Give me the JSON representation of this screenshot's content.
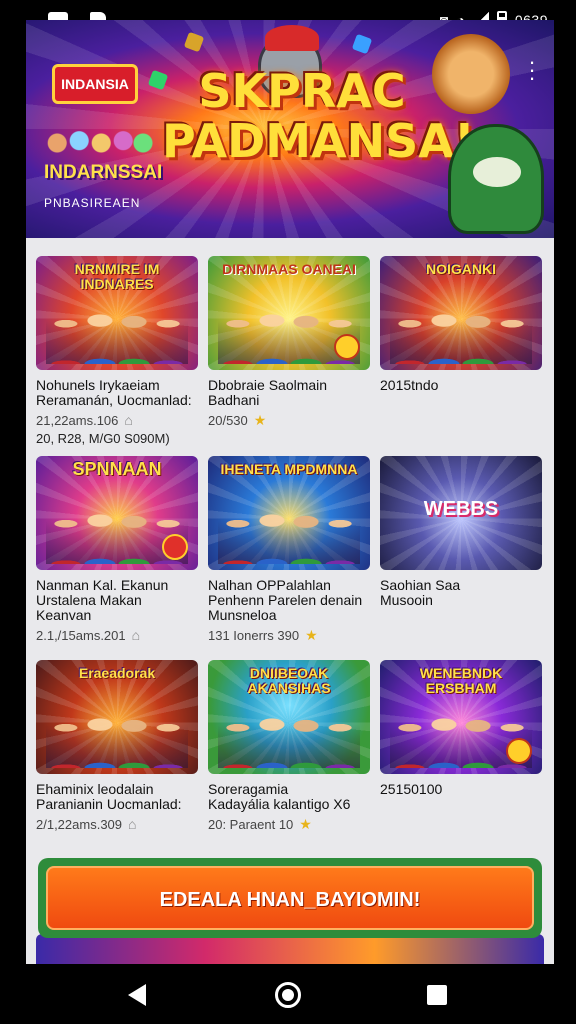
{
  "status_bar": {
    "time": "0639",
    "icons": [
      "image-icon",
      "document-icon",
      "cast-icon",
      "wifi-icon",
      "signal-icon",
      "battery-icon"
    ]
  },
  "hero": {
    "logo_text": "INDANSIA",
    "title": "SKPRAC PADMANSA!",
    "subtitle": "INDARNSSAI",
    "tagline": "PNBASIREAEN"
  },
  "games": [
    {
      "thumb_title": "NRNMIRE IM INDNARES",
      "title": "Nohunels Irykaeiam\nReramanán, Uocmanlad:",
      "meta": "21,22ams.106",
      "sub": "20, R28, M/G0 S090M)",
      "theme": "red"
    },
    {
      "thumb_title": "DIRNMAAS OANEAI",
      "title": "Dbobraie Saolmain\nBadhani",
      "meta": "20/530",
      "sub": "",
      "theme": "yellow"
    },
    {
      "thumb_title": "NOIGANKI",
      "title": "2015tndo",
      "meta": "",
      "sub": "",
      "theme": "purple"
    },
    {
      "thumb_title": "SPNNAAN",
      "title": "Nanman Kal. Ekanun\nUrstalena Makan\nKeanvan",
      "meta": "2.1,/15ams.201",
      "sub": "",
      "theme": "magenta"
    },
    {
      "thumb_title": "IHENETA MPDMNNA",
      "title": "Nalhan OPPalahlan\nPenhenn Parelen denain\nMunsneloa",
      "meta": "131 Ionerrs 390",
      "sub": "",
      "theme": "blue"
    },
    {
      "thumb_title": "WEBBS",
      "title": "Saohian Saa\nMusooin",
      "meta": "",
      "sub": "",
      "theme": "dark"
    },
    {
      "thumb_title": "Eraeadorak",
      "title": "Ehaminix leodalain\nParanianin Uocmanlad:",
      "meta": "2/1,22ams.309",
      "sub": "",
      "theme": "orange"
    },
    {
      "thumb_title": "DNIIBEOAK AKANSIHAS",
      "title": "Soreragamia\nKadayália kalantigo X6",
      "meta": "20: Paraent 10",
      "sub": "",
      "theme": "green"
    },
    {
      "thumb_title": "WENEBNDK ERSBHAM",
      "title": "25150100",
      "meta": "",
      "sub": "",
      "theme": "violet"
    }
  ],
  "cta": {
    "label": "EDEALA HNAN_BAYIOMIN!"
  },
  "nav": {
    "back": "back-icon",
    "home": "home-icon",
    "recents": "recents-icon"
  }
}
